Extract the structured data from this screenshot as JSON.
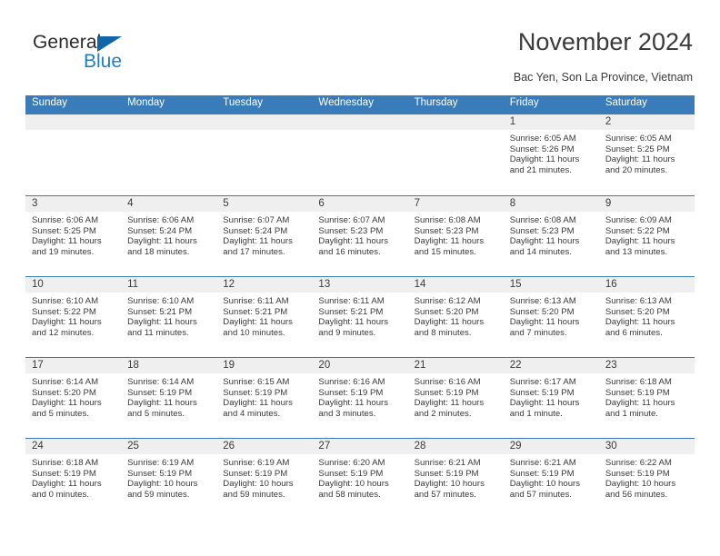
{
  "logo": {
    "word_one": "General",
    "word_two": "Blue",
    "triangle_color": "#1064a8",
    "blue_color": "#1f7ec4"
  },
  "header": {
    "title": "November 2024",
    "location": "Bac Yen, Son La Province, Vietnam"
  },
  "theme": {
    "header_blue": "#3a7cba",
    "daynum_band": "#efefef",
    "text": "#3a3a3a"
  },
  "weekdays": [
    "Sunday",
    "Monday",
    "Tuesday",
    "Wednesday",
    "Thursday",
    "Friday",
    "Saturday"
  ],
  "weeks": [
    [
      {
        "day": "",
        "sunrise": "",
        "sunset": "",
        "daylight_line1": "",
        "daylight_line2": ""
      },
      {
        "day": "",
        "sunrise": "",
        "sunset": "",
        "daylight_line1": "",
        "daylight_line2": ""
      },
      {
        "day": "",
        "sunrise": "",
        "sunset": "",
        "daylight_line1": "",
        "daylight_line2": ""
      },
      {
        "day": "",
        "sunrise": "",
        "sunset": "",
        "daylight_line1": "",
        "daylight_line2": ""
      },
      {
        "day": "",
        "sunrise": "",
        "sunset": "",
        "daylight_line1": "",
        "daylight_line2": ""
      },
      {
        "day": "1",
        "sunrise": "Sunrise: 6:05 AM",
        "sunset": "Sunset: 5:26 PM",
        "daylight_line1": "Daylight: 11 hours",
        "daylight_line2": "and 21 minutes."
      },
      {
        "day": "2",
        "sunrise": "Sunrise: 6:05 AM",
        "sunset": "Sunset: 5:25 PM",
        "daylight_line1": "Daylight: 11 hours",
        "daylight_line2": "and 20 minutes."
      }
    ],
    [
      {
        "day": "3",
        "sunrise": "Sunrise: 6:06 AM",
        "sunset": "Sunset: 5:25 PM",
        "daylight_line1": "Daylight: 11 hours",
        "daylight_line2": "and 19 minutes."
      },
      {
        "day": "4",
        "sunrise": "Sunrise: 6:06 AM",
        "sunset": "Sunset: 5:24 PM",
        "daylight_line1": "Daylight: 11 hours",
        "daylight_line2": "and 18 minutes."
      },
      {
        "day": "5",
        "sunrise": "Sunrise: 6:07 AM",
        "sunset": "Sunset: 5:24 PM",
        "daylight_line1": "Daylight: 11 hours",
        "daylight_line2": "and 17 minutes."
      },
      {
        "day": "6",
        "sunrise": "Sunrise: 6:07 AM",
        "sunset": "Sunset: 5:23 PM",
        "daylight_line1": "Daylight: 11 hours",
        "daylight_line2": "and 16 minutes."
      },
      {
        "day": "7",
        "sunrise": "Sunrise: 6:08 AM",
        "sunset": "Sunset: 5:23 PM",
        "daylight_line1": "Daylight: 11 hours",
        "daylight_line2": "and 15 minutes."
      },
      {
        "day": "8",
        "sunrise": "Sunrise: 6:08 AM",
        "sunset": "Sunset: 5:23 PM",
        "daylight_line1": "Daylight: 11 hours",
        "daylight_line2": "and 14 minutes."
      },
      {
        "day": "9",
        "sunrise": "Sunrise: 6:09 AM",
        "sunset": "Sunset: 5:22 PM",
        "daylight_line1": "Daylight: 11 hours",
        "daylight_line2": "and 13 minutes."
      }
    ],
    [
      {
        "day": "10",
        "sunrise": "Sunrise: 6:10 AM",
        "sunset": "Sunset: 5:22 PM",
        "daylight_line1": "Daylight: 11 hours",
        "daylight_line2": "and 12 minutes."
      },
      {
        "day": "11",
        "sunrise": "Sunrise: 6:10 AM",
        "sunset": "Sunset: 5:21 PM",
        "daylight_line1": "Daylight: 11 hours",
        "daylight_line2": "and 11 minutes."
      },
      {
        "day": "12",
        "sunrise": "Sunrise: 6:11 AM",
        "sunset": "Sunset: 5:21 PM",
        "daylight_line1": "Daylight: 11 hours",
        "daylight_line2": "and 10 minutes."
      },
      {
        "day": "13",
        "sunrise": "Sunrise: 6:11 AM",
        "sunset": "Sunset: 5:21 PM",
        "daylight_line1": "Daylight: 11 hours",
        "daylight_line2": "and 9 minutes."
      },
      {
        "day": "14",
        "sunrise": "Sunrise: 6:12 AM",
        "sunset": "Sunset: 5:20 PM",
        "daylight_line1": "Daylight: 11 hours",
        "daylight_line2": "and 8 minutes."
      },
      {
        "day": "15",
        "sunrise": "Sunrise: 6:13 AM",
        "sunset": "Sunset: 5:20 PM",
        "daylight_line1": "Daylight: 11 hours",
        "daylight_line2": "and 7 minutes."
      },
      {
        "day": "16",
        "sunrise": "Sunrise: 6:13 AM",
        "sunset": "Sunset: 5:20 PM",
        "daylight_line1": "Daylight: 11 hours",
        "daylight_line2": "and 6 minutes."
      }
    ],
    [
      {
        "day": "17",
        "sunrise": "Sunrise: 6:14 AM",
        "sunset": "Sunset: 5:20 PM",
        "daylight_line1": "Daylight: 11 hours",
        "daylight_line2": "and 5 minutes."
      },
      {
        "day": "18",
        "sunrise": "Sunrise: 6:14 AM",
        "sunset": "Sunset: 5:19 PM",
        "daylight_line1": "Daylight: 11 hours",
        "daylight_line2": "and 5 minutes."
      },
      {
        "day": "19",
        "sunrise": "Sunrise: 6:15 AM",
        "sunset": "Sunset: 5:19 PM",
        "daylight_line1": "Daylight: 11 hours",
        "daylight_line2": "and 4 minutes."
      },
      {
        "day": "20",
        "sunrise": "Sunrise: 6:16 AM",
        "sunset": "Sunset: 5:19 PM",
        "daylight_line1": "Daylight: 11 hours",
        "daylight_line2": "and 3 minutes."
      },
      {
        "day": "21",
        "sunrise": "Sunrise: 6:16 AM",
        "sunset": "Sunset: 5:19 PM",
        "daylight_line1": "Daylight: 11 hours",
        "daylight_line2": "and 2 minutes."
      },
      {
        "day": "22",
        "sunrise": "Sunrise: 6:17 AM",
        "sunset": "Sunset: 5:19 PM",
        "daylight_line1": "Daylight: 11 hours",
        "daylight_line2": "and 1 minute."
      },
      {
        "day": "23",
        "sunrise": "Sunrise: 6:18 AM",
        "sunset": "Sunset: 5:19 PM",
        "daylight_line1": "Daylight: 11 hours",
        "daylight_line2": "and 1 minute."
      }
    ],
    [
      {
        "day": "24",
        "sunrise": "Sunrise: 6:18 AM",
        "sunset": "Sunset: 5:19 PM",
        "daylight_line1": "Daylight: 11 hours",
        "daylight_line2": "and 0 minutes."
      },
      {
        "day": "25",
        "sunrise": "Sunrise: 6:19 AM",
        "sunset": "Sunset: 5:19 PM",
        "daylight_line1": "Daylight: 10 hours",
        "daylight_line2": "and 59 minutes."
      },
      {
        "day": "26",
        "sunrise": "Sunrise: 6:19 AM",
        "sunset": "Sunset: 5:19 PM",
        "daylight_line1": "Daylight: 10 hours",
        "daylight_line2": "and 59 minutes."
      },
      {
        "day": "27",
        "sunrise": "Sunrise: 6:20 AM",
        "sunset": "Sunset: 5:19 PM",
        "daylight_line1": "Daylight: 10 hours",
        "daylight_line2": "and 58 minutes."
      },
      {
        "day": "28",
        "sunrise": "Sunrise: 6:21 AM",
        "sunset": "Sunset: 5:19 PM",
        "daylight_line1": "Daylight: 10 hours",
        "daylight_line2": "and 57 minutes."
      },
      {
        "day": "29",
        "sunrise": "Sunrise: 6:21 AM",
        "sunset": "Sunset: 5:19 PM",
        "daylight_line1": "Daylight: 10 hours",
        "daylight_line2": "and 57 minutes."
      },
      {
        "day": "30",
        "sunrise": "Sunrise: 6:22 AM",
        "sunset": "Sunset: 5:19 PM",
        "daylight_line1": "Daylight: 10 hours",
        "daylight_line2": "and 56 minutes."
      }
    ]
  ]
}
